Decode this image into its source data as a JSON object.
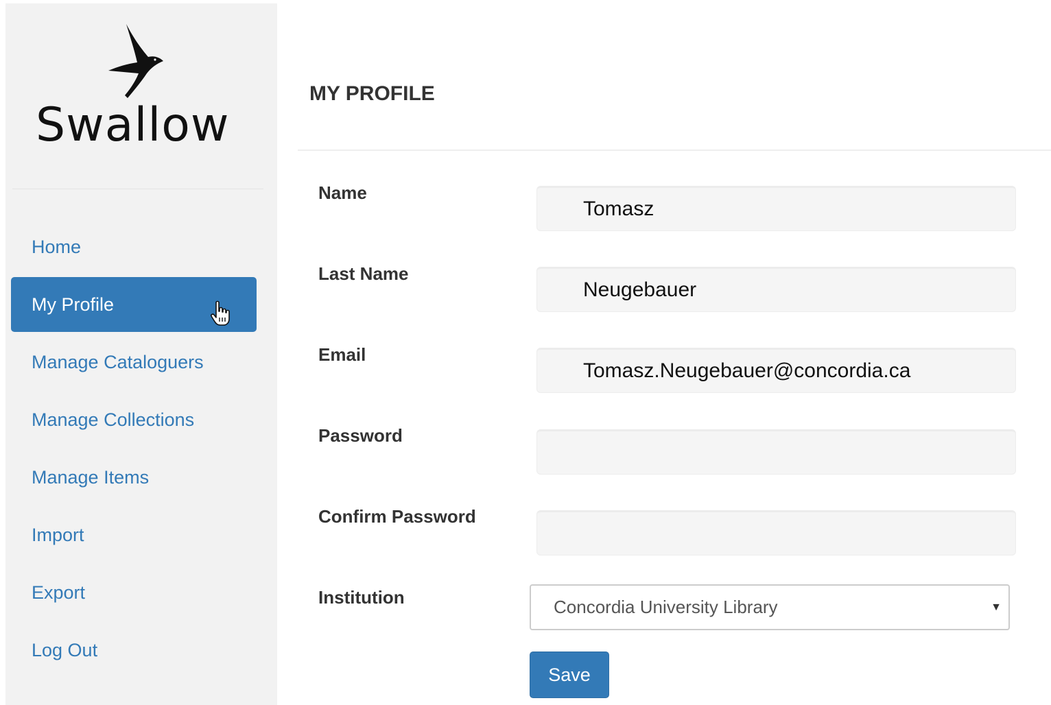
{
  "brand": {
    "name": "Swallow",
    "logo_icon": "swallow-bird-icon"
  },
  "sidebar": {
    "items": [
      {
        "label": "Home",
        "active": false
      },
      {
        "label": "My Profile",
        "active": true
      },
      {
        "label": "Manage Cataloguers",
        "active": false
      },
      {
        "label": "Manage Collections",
        "active": false
      },
      {
        "label": "Manage Items",
        "active": false
      },
      {
        "label": "Import",
        "active": false
      },
      {
        "label": "Export",
        "active": false
      },
      {
        "label": "Log Out",
        "active": false
      }
    ]
  },
  "page": {
    "title": "MY PROFILE"
  },
  "form": {
    "name": {
      "label": "Name",
      "value": "Tomasz"
    },
    "last_name": {
      "label": "Last Name",
      "value": "Neugebauer"
    },
    "email": {
      "label": "Email",
      "value": "Tomasz.Neugebauer@concordia.ca"
    },
    "password": {
      "label": "Password",
      "value": ""
    },
    "confirm_password": {
      "label": "Confirm Password",
      "value": ""
    },
    "institution": {
      "label": "Institution",
      "selected": "Concordia University Library"
    },
    "save_label": "Save"
  },
  "colors": {
    "accent": "#337ab7",
    "sidebar_bg": "#f2f2f2",
    "input_bg": "#f5f5f5"
  }
}
